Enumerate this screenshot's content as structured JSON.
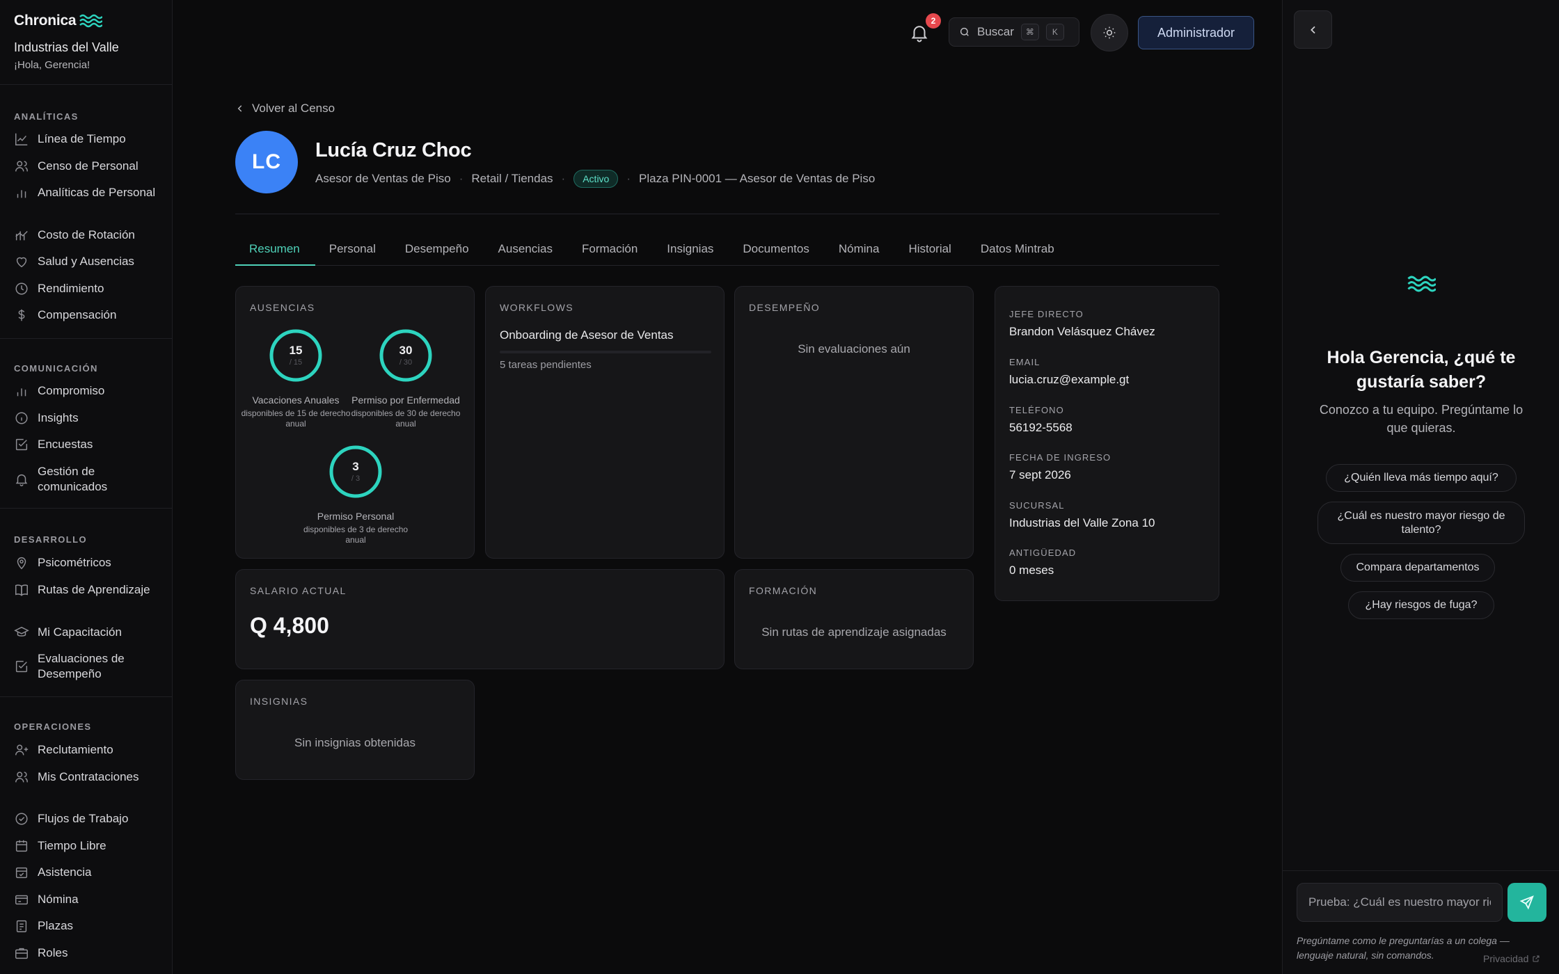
{
  "sidebar": {
    "brand": "Chronica",
    "company": "Industrias del Valle",
    "greeting": "¡Hola, Gerencia!",
    "sections": {
      "analytics": {
        "heading": "ANALÍTICAS",
        "items": [
          {
            "label": "Línea de Tiempo",
            "icon": "line-chart-icon"
          },
          {
            "label": "Censo de Personal",
            "icon": "users-icon"
          },
          {
            "label": "Analíticas de Personal",
            "icon": "bar-chart-icon"
          },
          {
            "label": "Costo de Rotación",
            "icon": "chart-icon"
          },
          {
            "label": "Salud y Ausencias",
            "icon": "heart-icon"
          },
          {
            "label": "Rendimiento",
            "icon": "clock-icon"
          },
          {
            "label": "Compensación",
            "icon": "dollar-icon"
          }
        ]
      },
      "communication": {
        "heading": "COMUNICACIÓN",
        "items": [
          {
            "label": "Compromiso",
            "icon": "bar-chart-icon"
          },
          {
            "label": "Insights",
            "icon": "info-icon"
          },
          {
            "label": "Encuestas",
            "icon": "checkbox-icon"
          },
          {
            "label": "Gestión de comunicados",
            "icon": "bell-icon"
          }
        ]
      },
      "development": {
        "heading": "DESARROLLO",
        "items": [
          {
            "label": "Psicométricos",
            "icon": "location-pin-icon"
          },
          {
            "label": "Rutas de Aprendizaje",
            "icon": "book-icon"
          },
          {
            "label": "Mi Capacitación",
            "icon": "graduation-cap-icon"
          },
          {
            "label": "Evaluaciones de Desempeño",
            "icon": "checkbox-icon"
          }
        ]
      },
      "operations": {
        "heading": "OPERACIONES",
        "items": [
          {
            "label": "Reclutamiento",
            "icon": "user-plus-icon"
          },
          {
            "label": "Mis Contrataciones",
            "icon": "users-icon"
          },
          {
            "label": "Flujos de Trabajo",
            "icon": "check-circle-icon"
          },
          {
            "label": "Tiempo Libre",
            "icon": "calendar-icon"
          },
          {
            "label": "Asistencia",
            "icon": "calendar-check-icon"
          },
          {
            "label": "Nómina",
            "icon": "wallet-icon"
          },
          {
            "label": "Plazas",
            "icon": "clipboard-icon"
          },
          {
            "label": "Roles",
            "icon": "briefcase-icon"
          }
        ]
      }
    }
  },
  "topbar": {
    "notification_count": "2",
    "search_label": "Buscar",
    "kbd_cmd": "⌘",
    "kbd_k": "K",
    "admin_label": "Administrador"
  },
  "profile": {
    "back_label": "Volver al Censo",
    "initials": "LC",
    "name": "Lucía Cruz Choc",
    "position": "Asesor de Ventas de Piso",
    "department": "Retail / Tiendas",
    "status": "Activo",
    "plaza": "Plaza PIN-0001 — Asesor de Ventas de Piso",
    "avatar_color": "#3b82f6"
  },
  "tabs": [
    "Resumen",
    "Personal",
    "Desempeño",
    "Ausencias",
    "Formación",
    "Insignias",
    "Documentos",
    "Nómina",
    "Historial",
    "Datos Mintrab"
  ],
  "cards": {
    "absences": {
      "title": "AUSENCIAS",
      "rings": [
        {
          "value": "15",
          "total": "/ 15",
          "label": "Vacaciones Anuales",
          "desc": "disponibles de 15 de derecho anual"
        },
        {
          "value": "30",
          "total": "/ 30",
          "label": "Permiso por Enfermedad",
          "desc": "disponibles de 30 de derecho anual"
        },
        {
          "value": "3",
          "total": "/ 3",
          "label": "Permiso Personal",
          "desc": "disponibles de 3 de derecho anual"
        }
      ],
      "ring_color": "#2dd4bf"
    },
    "workflows": {
      "title": "WORKFLOWS",
      "item": "Onboarding de Asesor de Ventas",
      "tasks": "5 tareas pendientes"
    },
    "performance": {
      "title": "DESEMPEÑO",
      "empty": "Sin evaluaciones aún"
    },
    "salary": {
      "title": "SALARIO ACTUAL",
      "value": "Q 4,800"
    },
    "training": {
      "title": "FORMACIÓN",
      "empty": "Sin rutas de aprendizaje asignadas"
    },
    "badges": {
      "title": "INSIGNIAS",
      "empty": "Sin insignias obtenidas"
    },
    "info": {
      "manager_label": "JEFE DIRECTO",
      "manager": "Brandon Velásquez Chávez",
      "email_label": "EMAIL",
      "email": "lucia.cruz@example.gt",
      "phone_label": "TELÉFONO",
      "phone": "56192-5568",
      "hire_label": "FECHA DE INGRESO",
      "hire_date": "7 sept 2026",
      "branch_label": "SUCURSAL",
      "branch": "Industrias del Valle Zona 10",
      "tenure_label": "ANTIGÜEDAD",
      "tenure": "0 meses"
    }
  },
  "assistant": {
    "title": "Hola Gerencia, ¿qué te gustaría saber?",
    "subtitle": "Conozco a tu equipo. Pregúntame lo que quieras.",
    "suggestions": [
      "¿Quién lleva más tiempo aquí?",
      "¿Cuál es nuestro mayor riesgo de talento?",
      "Compara departamentos",
      "¿Hay riesgos de fuga?"
    ],
    "input_placeholder": "Prueba: ¿Cuál es nuestro mayor riesgo de talento?",
    "hint": "Pregúntame como le preguntarías a un colega — lenguaje natural, sin comandos.",
    "privacy": "Privacidad",
    "accent_color": "#23b59d"
  }
}
